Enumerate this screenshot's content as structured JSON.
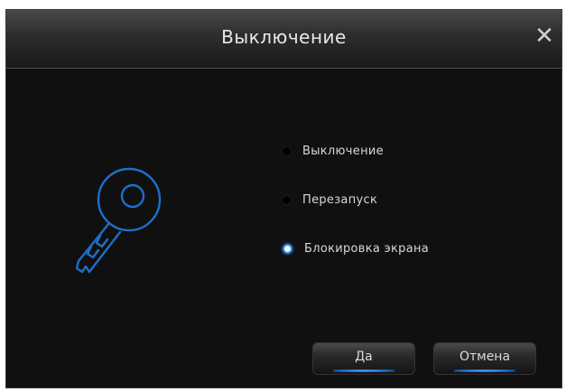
{
  "dialog": {
    "title": "Выключение",
    "close_glyph": "✕"
  },
  "options": [
    {
      "label": "Выключение",
      "selected": false
    },
    {
      "label": "Перезапуск",
      "selected": false
    },
    {
      "label": "Блокировка экрана",
      "selected": true
    }
  ],
  "buttons": {
    "ok_label": "Да",
    "cancel_label": "Отмена"
  },
  "icons": {
    "main": "key-icon",
    "close": "close-icon"
  },
  "colors": {
    "accent": "#2a86f0",
    "key_stroke": "#1f6fc8",
    "background": "#101010"
  }
}
